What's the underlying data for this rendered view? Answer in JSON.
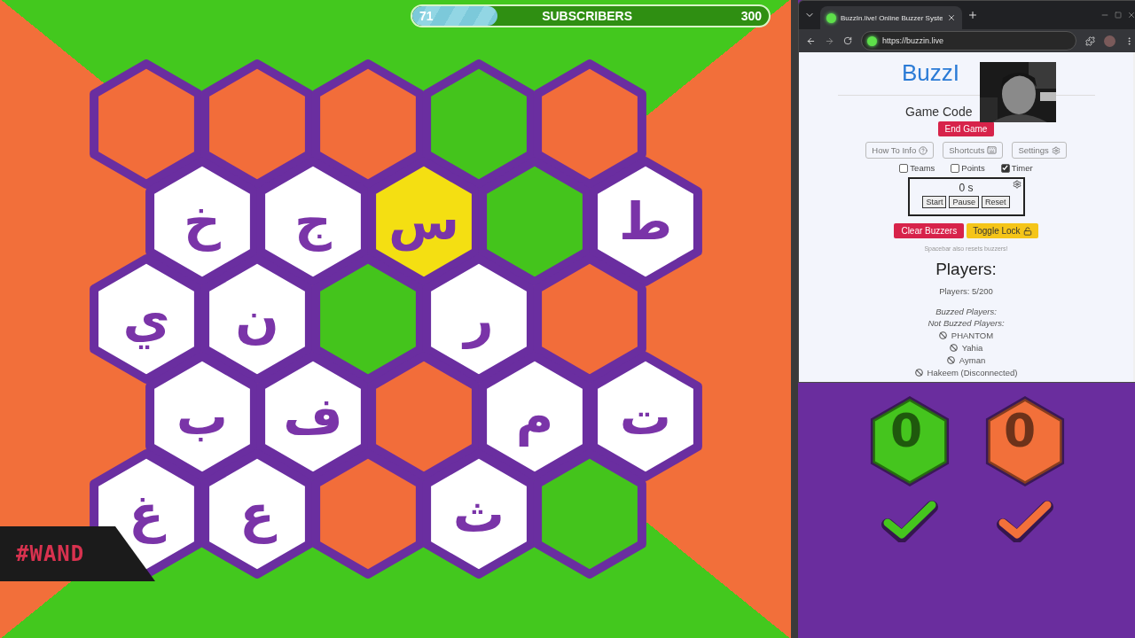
{
  "stream_bar": {
    "current": "71",
    "label": "SUBSCRIBERS",
    "goal": "300",
    "level": 0.24
  },
  "board": {
    "rows": [
      {
        "cells": [
          {
            "color": "#f26d3a"
          },
          {
            "color": "#f26d3a"
          },
          {
            "color": "#f26d3a"
          },
          {
            "color": "#44c41c"
          },
          {
            "color": "#f26d3a"
          }
        ]
      },
      {
        "cells": [
          {
            "color": "#ffffff",
            "letter": "خ"
          },
          {
            "color": "#ffffff",
            "letter": "ج"
          },
          {
            "color": "#f4df12",
            "letter": "س"
          },
          {
            "color": "#44c41c"
          },
          {
            "color": "#ffffff",
            "letter": "ط"
          }
        ]
      },
      {
        "cells": [
          {
            "color": "#ffffff",
            "letter": "ي"
          },
          {
            "color": "#ffffff",
            "letter": "ن"
          },
          {
            "color": "#44c41c"
          },
          {
            "color": "#ffffff",
            "letter": "ر"
          },
          {
            "color": "#f26d3a"
          }
        ]
      },
      {
        "cells": [
          {
            "color": "#ffffff",
            "letter": "ب"
          },
          {
            "color": "#ffffff",
            "letter": "ف"
          },
          {
            "color": "#f26d3a"
          },
          {
            "color": "#ffffff",
            "letter": "م"
          },
          {
            "color": "#ffffff",
            "letter": "ت"
          }
        ]
      },
      {
        "cells": [
          {
            "color": "#ffffff",
            "letter": "غ"
          },
          {
            "color": "#ffffff",
            "letter": "ع"
          },
          {
            "color": "#f26d3a"
          },
          {
            "color": "#ffffff",
            "letter": "ث"
          },
          {
            "color": "#44c41c"
          }
        ]
      }
    ]
  },
  "logo": {
    "text": "#WAND"
  },
  "browser": {
    "tab": {
      "title": "BuzzIn.live! Online Buzzer Syste"
    },
    "url": "https://buzzin.live",
    "page": {
      "title": "BuzzI",
      "game_code_label": "Game Code",
      "end_button": "End Game",
      "tool_buttons": [
        {
          "label": "How To Info",
          "kind": "help"
        },
        {
          "label": "Shortcuts",
          "kind": "keyboard"
        },
        {
          "label": "Settings",
          "kind": "gear"
        }
      ],
      "options": [
        {
          "label": "Teams",
          "checked": false
        },
        {
          "label": "Points",
          "checked": false
        },
        {
          "label": "Timer",
          "checked": true
        }
      ],
      "timer": {
        "reading": "0 s",
        "buttons": [
          "Start",
          "Pause",
          "Reset"
        ]
      },
      "clear_button": "Clear Buzzers",
      "lock_button": "Toggle Lock",
      "hint": "Spacebar also resets buzzers!",
      "players_heading": "Players:",
      "players_count": "Players: 5/200",
      "buzzed_label": "Buzzed Players:",
      "not_buzzed_label": "Not Buzzed Players:",
      "not_buzzed": [
        "PHANTOM",
        "Yahia",
        "Ayman",
        "Hakeem (Disconnected)"
      ]
    }
  },
  "teams": [
    {
      "color": "#45c51e",
      "score": "0"
    },
    {
      "color": "#f2703a",
      "score": "0"
    }
  ]
}
